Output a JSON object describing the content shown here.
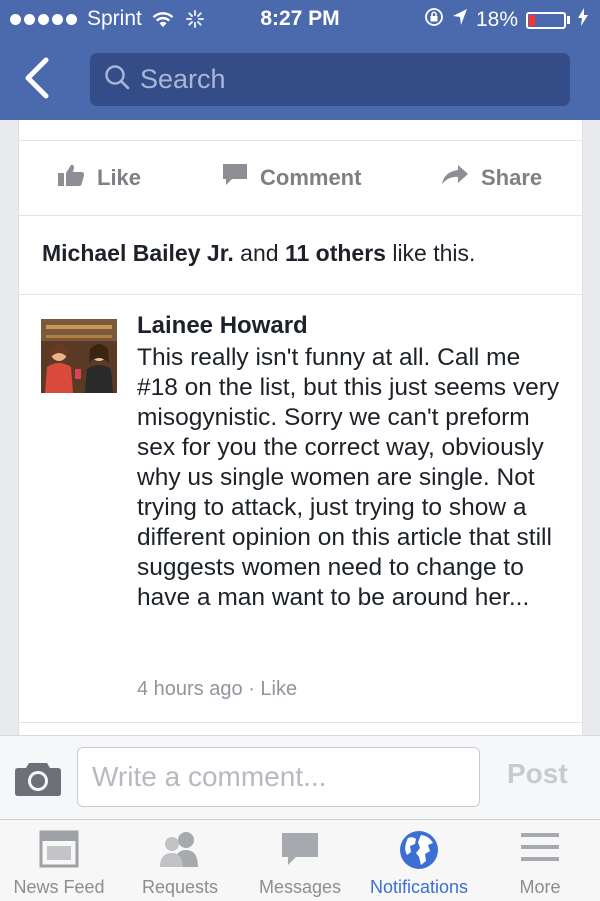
{
  "status_bar": {
    "carrier": "Sprint",
    "time": "8:27 PM",
    "battery": "18%",
    "battery_level": 0.18
  },
  "nav": {
    "search_placeholder": "Search"
  },
  "post_actions": {
    "like": "Like",
    "comment": "Comment",
    "share": "Share"
  },
  "likes": {
    "name": "Michael Bailey Jr.",
    "and": " and ",
    "others": "11 others",
    "suffix": " like this."
  },
  "comment": {
    "author": "Lainee Howard",
    "text": "This really isn't funny at all. Call me #18 on the list, but this just seems very misogynistic. Sorry we can't preform sex for you the correct way, obviously why us single women are single. Not trying to attack, just trying to show a different opinion on this article that still suggests women need to change to have a man want to be around her...",
    "time": "4 hours ago",
    "separator": " · ",
    "like_label": "Like"
  },
  "compose": {
    "placeholder": "Write a comment...",
    "post_label": "Post"
  },
  "tabs": [
    {
      "label": "News Feed",
      "icon": "news-feed-icon"
    },
    {
      "label": "Requests",
      "icon": "friend-requests-icon"
    },
    {
      "label": "Messages",
      "icon": "messages-icon"
    },
    {
      "label": "Notifications",
      "icon": "globe-icon",
      "active": true
    },
    {
      "label": "More",
      "icon": "menu-icon"
    }
  ],
  "colors": {
    "header": "#4a6aad",
    "search_box": "#344d88",
    "active_tab": "#3b6fd4",
    "battery_low": "#ff3030"
  }
}
